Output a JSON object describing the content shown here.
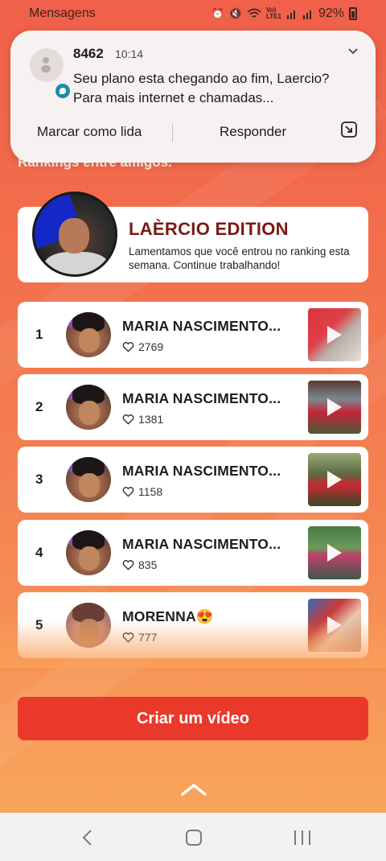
{
  "status_bar": {
    "app_label": "Mensagens",
    "battery": "92%",
    "icons": [
      "alarm-icon",
      "mute-icon",
      "wifi-icon",
      "volte-lte1-icon",
      "signal-icon",
      "signal-icon",
      "battery-icon"
    ]
  },
  "background": {
    "section_title": "Rankings entre amigos."
  },
  "notification": {
    "sender": "8462",
    "time": "10:14",
    "message": "Seu plano esta chegando ao fim, Laercio? Para mais internet e chamadas...",
    "actions": {
      "mark_read": "Marcar como lida",
      "reply": "Responder"
    }
  },
  "user_card": {
    "name": "LAÈRCIO EDITION",
    "message": "Lamentamos que você entrou no ranking esta semana. Continue trabalhando!"
  },
  "ranking": [
    {
      "rank": "1",
      "name": "MARIA NASCIMENTO...",
      "likes": "2769"
    },
    {
      "rank": "2",
      "name": "MARIA NASCIMENTO...",
      "likes": "1381"
    },
    {
      "rank": "3",
      "name": "MARIA NASCIMENTO...",
      "likes": "1158"
    },
    {
      "rank": "4",
      "name": "MARIA NASCIMENTO...",
      "likes": "835"
    },
    {
      "rank": "5",
      "name": "MORENNA😍",
      "likes": "777"
    }
  ],
  "create_button": "Criar um vídeo",
  "colors": {
    "accent": "#e8392a",
    "user_name": "#7a1a14",
    "background_top": "#f0604a",
    "background_bottom": "#f9a85c"
  }
}
